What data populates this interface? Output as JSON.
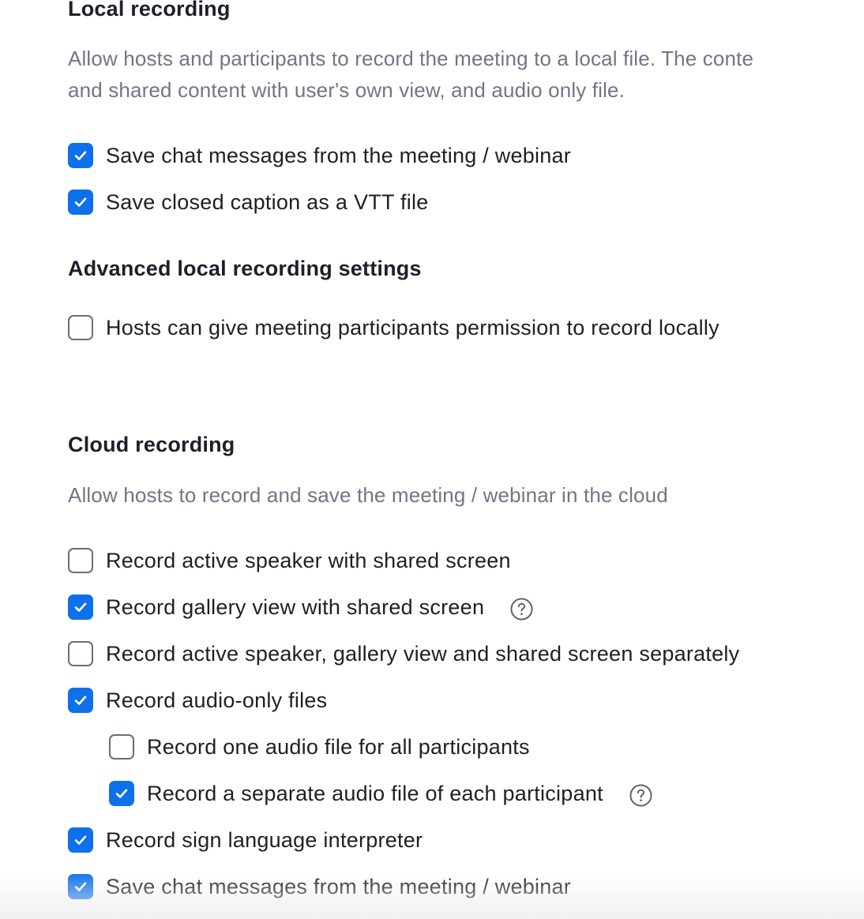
{
  "local_recording": {
    "title": "Local recording",
    "description_line1": "Allow hosts and participants to record the meeting to a local file. The conte",
    "description_line2": "and shared content with user's own view, and audio only file.",
    "options": [
      {
        "label": "Save chat messages from the meeting / webinar",
        "checked": true
      },
      {
        "label": "Save closed caption as a VTT file",
        "checked": true
      }
    ]
  },
  "advanced_local": {
    "title": "Advanced local recording settings",
    "options": [
      {
        "label": "Hosts can give meeting participants permission to record locally",
        "checked": false
      }
    ]
  },
  "cloud_recording": {
    "title": "Cloud recording",
    "description": "Allow hosts to record and save the meeting / webinar in the cloud",
    "options": [
      {
        "label": "Record active speaker with shared screen",
        "checked": false
      },
      {
        "label": "Record gallery view with shared screen",
        "checked": true,
        "help_icon": "question-circle-icon"
      },
      {
        "label": "Record active speaker, gallery view and shared screen separately",
        "checked": false
      },
      {
        "label": "Record audio-only files",
        "checked": true
      },
      {
        "label": "Record one audio file for all participants",
        "checked": false
      },
      {
        "label": "Record a separate audio file of each participant",
        "checked": true,
        "help_icon": "question-circle-icon"
      },
      {
        "label": "Record sign language interpreter",
        "checked": true
      },
      {
        "label": "Save chat messages from the meeting / webinar",
        "checked": true
      }
    ]
  },
  "colors": {
    "accent": "#0e71eb",
    "heading": "#1f1f2b",
    "description": "#747487",
    "checkbox_border": "#6c6c7c"
  }
}
